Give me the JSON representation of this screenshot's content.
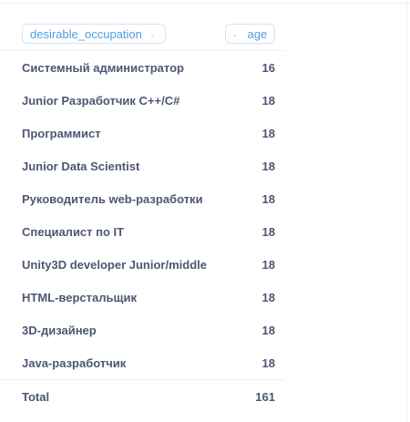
{
  "columns": {
    "occupation": "desirable_occupation",
    "age": "age"
  },
  "icons": {
    "sort": "chevron-down-icon"
  },
  "accent_color": "#509ee3",
  "rows": [
    {
      "occupation": "Системный администратор",
      "age": "16"
    },
    {
      "occupation": "Junior Разработчик C++/C#",
      "age": "18"
    },
    {
      "occupation": "Программист",
      "age": "18"
    },
    {
      "occupation": "Junior Data Scientist",
      "age": "18"
    },
    {
      "occupation": "Руководитель web-разработки",
      "age": "18"
    },
    {
      "occupation": "Специалист по IT",
      "age": "18"
    },
    {
      "occupation": "Unity3D developer Junior/middle",
      "age": "18"
    },
    {
      "occupation": "HTML-верстальщик",
      "age": "18"
    },
    {
      "occupation": "3D-дизайнер",
      "age": "18"
    },
    {
      "occupation": "Java-разработчик",
      "age": "18"
    }
  ],
  "total": {
    "label": "Total",
    "value": "161"
  }
}
